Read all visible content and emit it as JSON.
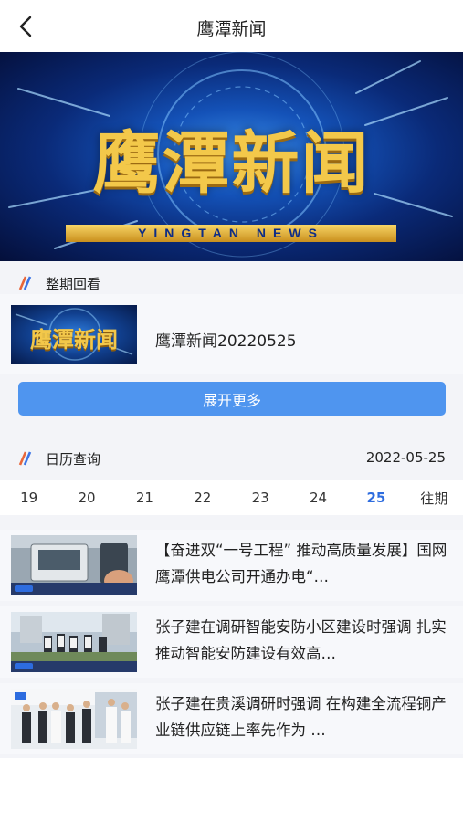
{
  "header": {
    "title": "鹰潭新闻"
  },
  "banner": {
    "logo_cn": "鹰潭新闻",
    "logo_en": "YINGTAN NEWS"
  },
  "replay_section": {
    "title": "整期回看",
    "item": {
      "thumb_text": "鹰潭新闻",
      "label": "鹰潭新闻20220525"
    },
    "expand_label": "展开更多"
  },
  "calendar_section": {
    "title": "日历查询",
    "selected_date": "2022-05-25",
    "days": [
      "19",
      "20",
      "21",
      "22",
      "23",
      "24",
      "25",
      "往期"
    ],
    "active_day": "25"
  },
  "news": [
    {
      "title": "【奋进双“一号工程” 推动高质量发展】国网鹰潭供电公司开通办电“…"
    },
    {
      "title": "张子建在调研智能安防小区建设时强调 扎实推动智能安防建设有效高…"
    },
    {
      "title": "张子建在贵溪调研时强调 在构建全流程铜产业链供应链上率先作为 …"
    }
  ],
  "colors": {
    "accent": "#4f95ef",
    "active_day": "#2d6cdf",
    "section_mark_a": "#e8663a",
    "section_mark_b": "#3c74e6"
  }
}
